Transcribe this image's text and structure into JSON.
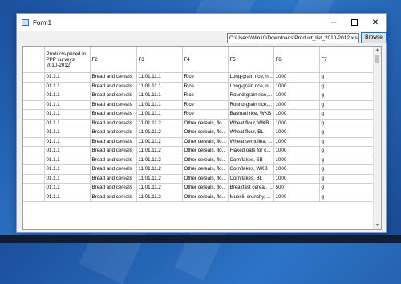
{
  "window": {
    "title": "Form1"
  },
  "controls": {
    "minimize": "─",
    "close": "✕"
  },
  "path_value": "C:\\Users\\Win10\\Downloads\\Product_list_2010-2012.xlsx",
  "browse_label": "Browse",
  "columns": [
    "Products priced in PPP surveys 2010-2012",
    "F2",
    "F3",
    "F4",
    "F5",
    "F6",
    "F7"
  ],
  "rows": [
    [
      "01.1.1",
      "Bread and cereals",
      "11.01.11.1",
      "Rice",
      "Long-grain rice, n...",
      "1000",
      "g"
    ],
    [
      "01.1.1",
      "Bread and cereals",
      "11.01.11.1",
      "Rice",
      "Long-grain rice, n...",
      "1000",
      "g"
    ],
    [
      "01.1.1",
      "Bread and cereals",
      "11.01.11.1",
      "Rice",
      "Round-grain rice,...",
      "1000",
      "g"
    ],
    [
      "01.1.1",
      "Bread and cereals",
      "11.01.11.1",
      "Rice",
      "Round-grain rice,...",
      "1000",
      "g"
    ],
    [
      "01.1.1",
      "Bread and cereals",
      "11.01.11.1",
      "Rice",
      "Basmati rice, WKB",
      "1000",
      "g"
    ],
    [
      "01.1.1",
      "Bread and cereals",
      "11.01.11.2",
      "Other cereals, flo...",
      "Wheat flour, WKB",
      "1000",
      "g"
    ],
    [
      "01.1.1",
      "Bread and cereals",
      "11.01.11.2",
      "Other cereals, flo...",
      "Wheat flour, BL",
      "1000",
      "g"
    ],
    [
      "01.1.1",
      "Bread and cereals",
      "11.01.11.2",
      "Other cereals, flo...",
      "Wheat semolina, ...",
      "1000",
      "g"
    ],
    [
      "01.1.1",
      "Bread and cereals",
      "11.01.11.2",
      "Other cereals, flo...",
      "Flaked oats for c...",
      "1000",
      "g"
    ],
    [
      "01.1.1",
      "Bread and cereals",
      "11.01.11.2",
      "Other cereals, flo...",
      "Cornflakes, SB",
      "1000",
      "g"
    ],
    [
      "01.1.1",
      "Bread and cereals",
      "11.01.11.2",
      "Other cereals, flo...",
      "Cornflakes, WKB",
      "1000",
      "g"
    ],
    [
      "01.1.1",
      "Bread and cereals",
      "11.01.11.2",
      "Other cereals, flo...",
      "Cornflakes, BL",
      "1000",
      "g"
    ],
    [
      "01.1.1",
      "Bread and cereals",
      "11.01.11.2",
      "Other cereals, flo...",
      "Breakfast cereal, ...",
      "500",
      "g"
    ],
    [
      "01.1.1",
      "Bread and cereals",
      "11.01.11.2",
      "Other cereals, flo...",
      "Muesli, crunchy, ...",
      "1000",
      "g"
    ]
  ],
  "scrollbar": {
    "up": "▲",
    "down": "▼"
  }
}
